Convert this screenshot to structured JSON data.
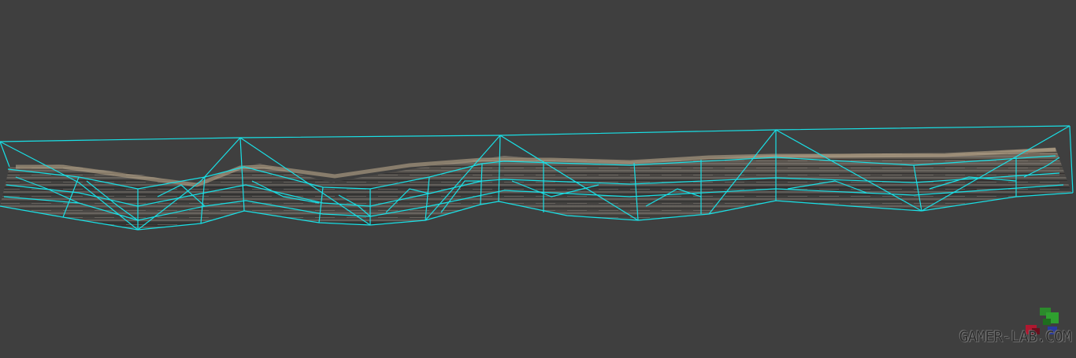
{
  "viewport": {
    "background_color": "#3f3f3f",
    "wire_color": "#19e0e6",
    "model_color": "#4a4743"
  },
  "watermark": {
    "text": "GAMER-LAB.COM",
    "logo_icon": "gamepad-logo-icon"
  }
}
